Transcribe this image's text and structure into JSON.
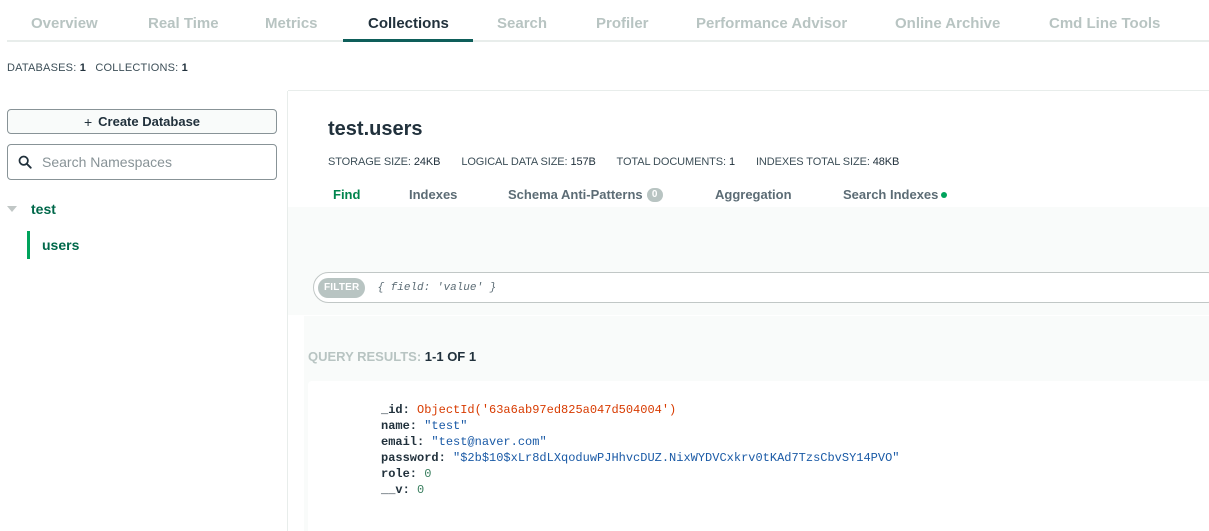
{
  "nav": {
    "tabs": [
      {
        "label": "Overview"
      },
      {
        "label": "Real Time"
      },
      {
        "label": "Metrics"
      },
      {
        "label": "Collections"
      },
      {
        "label": "Search"
      },
      {
        "label": "Profiler"
      },
      {
        "label": "Performance Advisor"
      },
      {
        "label": "Online Archive"
      },
      {
        "label": "Cmd Line Tools"
      }
    ],
    "active_tab": "Collections"
  },
  "counts": {
    "databases_label": "DATABASES:",
    "databases_value": "1",
    "collections_label": "COLLECTIONS:",
    "collections_value": "1"
  },
  "sidebar": {
    "create_db_label": "Create Database",
    "search_placeholder": "Search Namespaces",
    "database": "test",
    "collection": "users"
  },
  "collection": {
    "title": "test.users",
    "stats": [
      {
        "label": "STORAGE SIZE:",
        "value": "24KB"
      },
      {
        "label": "LOGICAL DATA SIZE:",
        "value": "157B"
      },
      {
        "label": "TOTAL DOCUMENTS:",
        "value": "1"
      },
      {
        "label": "INDEXES TOTAL SIZE:",
        "value": "48KB"
      }
    ],
    "subtabs": [
      {
        "label": "Find"
      },
      {
        "label": "Indexes"
      },
      {
        "label": "Schema Anti-Patterns",
        "badge": "0"
      },
      {
        "label": "Aggregation"
      },
      {
        "label": "Search Indexes"
      }
    ]
  },
  "filter": {
    "pill": "FILTER",
    "placeholder": "{ field: 'value' }"
  },
  "results": {
    "label": "QUERY RESULTS:",
    "range": "1-1 OF 1"
  },
  "document": {
    "id_key": "_id:",
    "id_value": "ObjectId('63a6ab97ed825a047d504004')",
    "name_key": "name:",
    "name_value": "\"test\"",
    "email_key": "email:",
    "email_value": "\"test@naver.com\"",
    "password_key": "password:",
    "password_value": "\"$2b$10$xLr8dLXqoduwPJHhvcDUZ.NixWYDVCxkrv0tKAd7TzsCbvSY14PVO\"",
    "role_key": "role:",
    "role_value": "0",
    "v_key": "__v:",
    "v_value": "0"
  },
  "colors": {
    "accent_green": "#00a35c",
    "text_dark": "#21313c",
    "muted": "#b8c4c2"
  }
}
